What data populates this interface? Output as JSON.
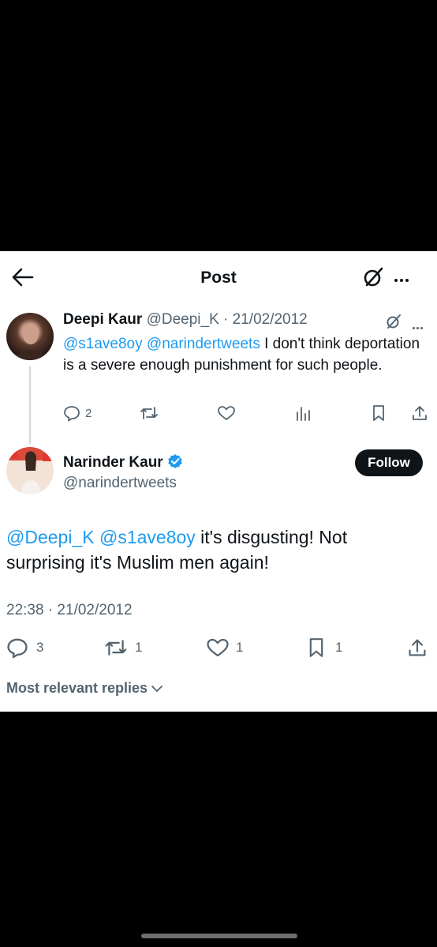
{
  "header": {
    "title": "Post"
  },
  "parent_tweet": {
    "author_name": "Deepi Kaur",
    "handle": "@Deepi_K",
    "date": "21/02/2012",
    "mention1": "@s1ave8oy",
    "mention2": "@narindertweets",
    "text": "I don't think deportation is a severe enough punishment for such people.",
    "reply_count": "2"
  },
  "main_tweet": {
    "author_name": "Narinder Kaur",
    "handle": "@narindertweets",
    "verified": true,
    "follow_label": "Follow",
    "mention1": "@Deepi_K",
    "mention2": "@s1ave8oy",
    "text": "it's disgusting! Not surprising it's Muslim men again!",
    "timestamp": "22:38 · 21/02/2012",
    "reply_count": "3",
    "repost_count": "1",
    "like_count": "1",
    "bookmark_count": "1"
  },
  "replies_filter": {
    "label": "Most relevant replies"
  },
  "colors": {
    "link": "#1d9bf0",
    "text": "#0f1419",
    "secondary": "#536471",
    "verified": "#1d9bf0"
  }
}
